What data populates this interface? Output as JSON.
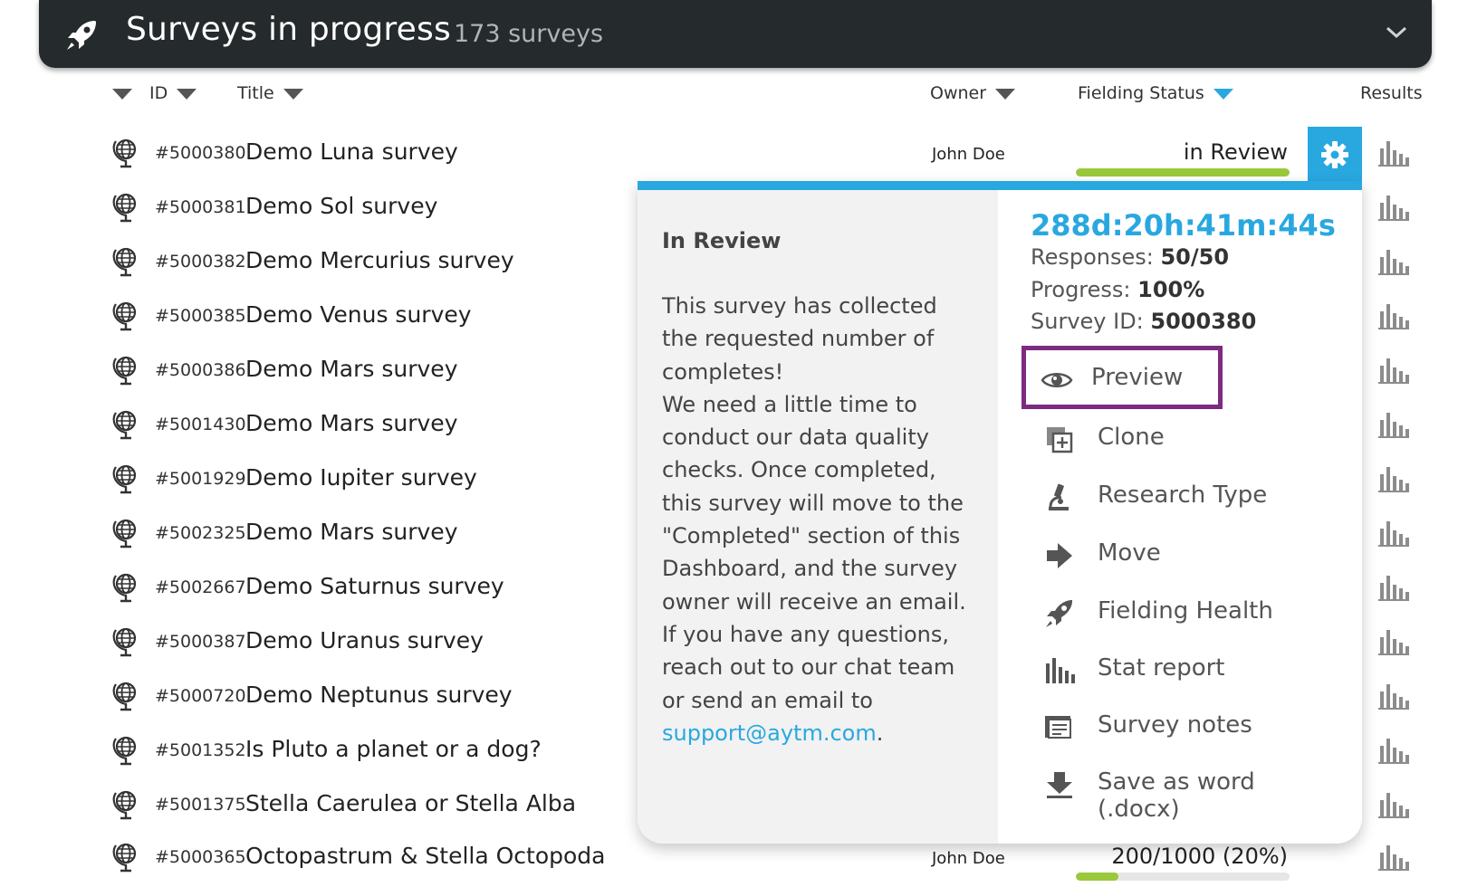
{
  "header": {
    "title": "Surveys in progress",
    "count": "173 surveys"
  },
  "columns": {
    "id": "ID",
    "title": "Title",
    "owner": "Owner",
    "status": "Fielding Status",
    "results": "Results"
  },
  "rows": [
    {
      "id": "#5000380",
      "title": "Demo Luna survey",
      "owner": "John Doe",
      "status": "in Review",
      "progress": 1.0
    },
    {
      "id": "#5000381",
      "title": "Demo Sol survey",
      "owner": "",
      "status": ""
    },
    {
      "id": "#5000382",
      "title": "Demo Mercurius survey",
      "owner": "",
      "status": ""
    },
    {
      "id": "#5000385",
      "title": "Demo Venus survey",
      "owner": "",
      "status": ""
    },
    {
      "id": "#5000386",
      "title": "Demo Mars survey",
      "owner": "",
      "status": ""
    },
    {
      "id": "#5001430",
      "title": "Demo Mars survey",
      "owner": "",
      "status": ""
    },
    {
      "id": "#5001929",
      "title": "Demo Iupiter survey",
      "owner": "",
      "status": ""
    },
    {
      "id": "#5002325",
      "title": "Demo Mars survey",
      "owner": "",
      "status": ""
    },
    {
      "id": "#5002667",
      "title": "Demo Saturnus survey",
      "owner": "",
      "status": ""
    },
    {
      "id": "#5000387",
      "title": "Demo Uranus survey",
      "owner": "",
      "status": ""
    },
    {
      "id": "#5000720",
      "title": "Demo Neptunus survey",
      "owner": "",
      "status": ""
    },
    {
      "id": "#5001352",
      "title": "Is Pluto a planet or a dog?",
      "owner": "",
      "status": ""
    },
    {
      "id": "#5001375",
      "title": "Stella Caerulea or Stella Alba",
      "owner": "",
      "status": ""
    },
    {
      "id": "#5000365",
      "title": "Octopastrum & Stella Octopoda",
      "owner": "John Doe",
      "status": "200/1000 (20%)",
      "progress": 0.2
    }
  ],
  "popup": {
    "title": "In Review",
    "body": "This survey has collected the requested number of completes!\nWe need a little time to conduct our data quality checks. Once completed, this survey will move to the \"Completed\" section of this Dashboard, and the survey owner will receive an email.\nIf you have any questions, reach out to our chat team or send an email to ",
    "link": "support@aytm.com",
    "link_suffix": ".",
    "timer": "288d:20h:41m:44s",
    "responses_label": "Responses: ",
    "responses_value": "50/50",
    "progress_label": "Progress: ",
    "progress_value": "100%",
    "survey_id_label": "Survey ID: ",
    "survey_id_value": "5000380",
    "menu": [
      {
        "label": "Preview",
        "icon": "eye-icon"
      },
      {
        "label": "Clone",
        "icon": "clone-icon"
      },
      {
        "label": "Research Type",
        "icon": "microscope-icon"
      },
      {
        "label": "Move",
        "icon": "arrow-right-icon"
      },
      {
        "label": "Fielding Health",
        "icon": "rocket-icon"
      },
      {
        "label": "Stat report",
        "icon": "bar-chart-icon"
      },
      {
        "label": "Survey notes",
        "icon": "notes-icon"
      },
      {
        "label": "Save as word (.docx)",
        "icon": "download-icon"
      }
    ]
  },
  "colors": {
    "header_bg": "#252a2c",
    "accent_blue": "#29a8e0",
    "progress_green": "#9ac83b",
    "highlight_purple": "#7c2b80"
  }
}
